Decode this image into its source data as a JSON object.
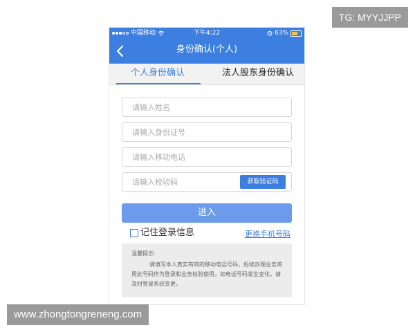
{
  "statusbar": {
    "carrier": "中国移动",
    "time": "下午4:22",
    "battery_text": "63%",
    "battery_level": 0.63,
    "colors": {
      "bar": "#3d7fe0",
      "battery": "#f5c542"
    }
  },
  "navbar": {
    "title": "身份确认(个人)",
    "back_icon": "chevron-left-icon"
  },
  "tabs": [
    {
      "label": "个人身份确认",
      "active": true
    },
    {
      "label": "法人股东身份确认",
      "active": false
    }
  ],
  "form": {
    "name_placeholder": "请输入姓名",
    "id_placeholder": "请输入身份证号",
    "phone_placeholder": "请输入移动电话",
    "code_placeholder": "请输入校验码",
    "get_code_label": "获取验证码",
    "submit_label": "进入",
    "remember_label": "记住登录信息",
    "remember_checked": false,
    "change_phone_label": "更换手机号码"
  },
  "notice": {
    "title": "温馨提示:",
    "body": "请填写本人真实有效的移动电话号码，后续办理业务将用此号码作为登录和业务校验使用，如电话号码发生变化，请及时登录系统变更。"
  },
  "watermarks": {
    "tg": "TG: MYYJJPP",
    "site": "www.zhongtongreneng.com"
  },
  "accent_color": "#3d7fe0"
}
